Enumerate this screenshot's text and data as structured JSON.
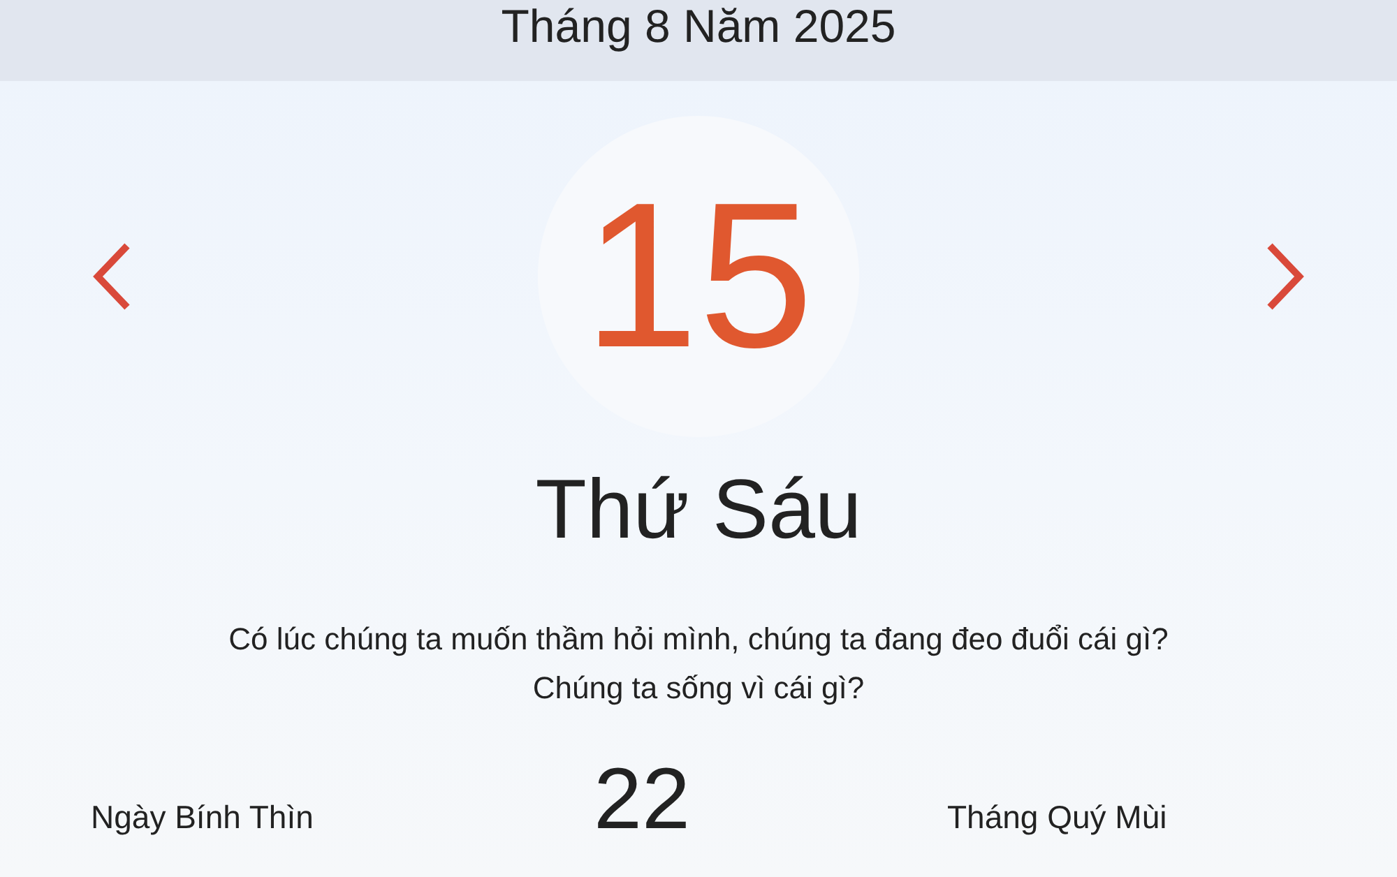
{
  "header": {
    "title": "Tháng 8 Năm 2025"
  },
  "day": {
    "number": "15",
    "weekday": "Thứ Sáu"
  },
  "quote": "Có lúc chúng ta muốn thầm hỏi mình, chúng ta đang đeo đuổi cái gì? Chúng ta sống vì cái gì?",
  "lunar": {
    "day_name": "Ngày Bính Thìn",
    "day_number": "22",
    "month_name": "Tháng Quý Mùi"
  }
}
